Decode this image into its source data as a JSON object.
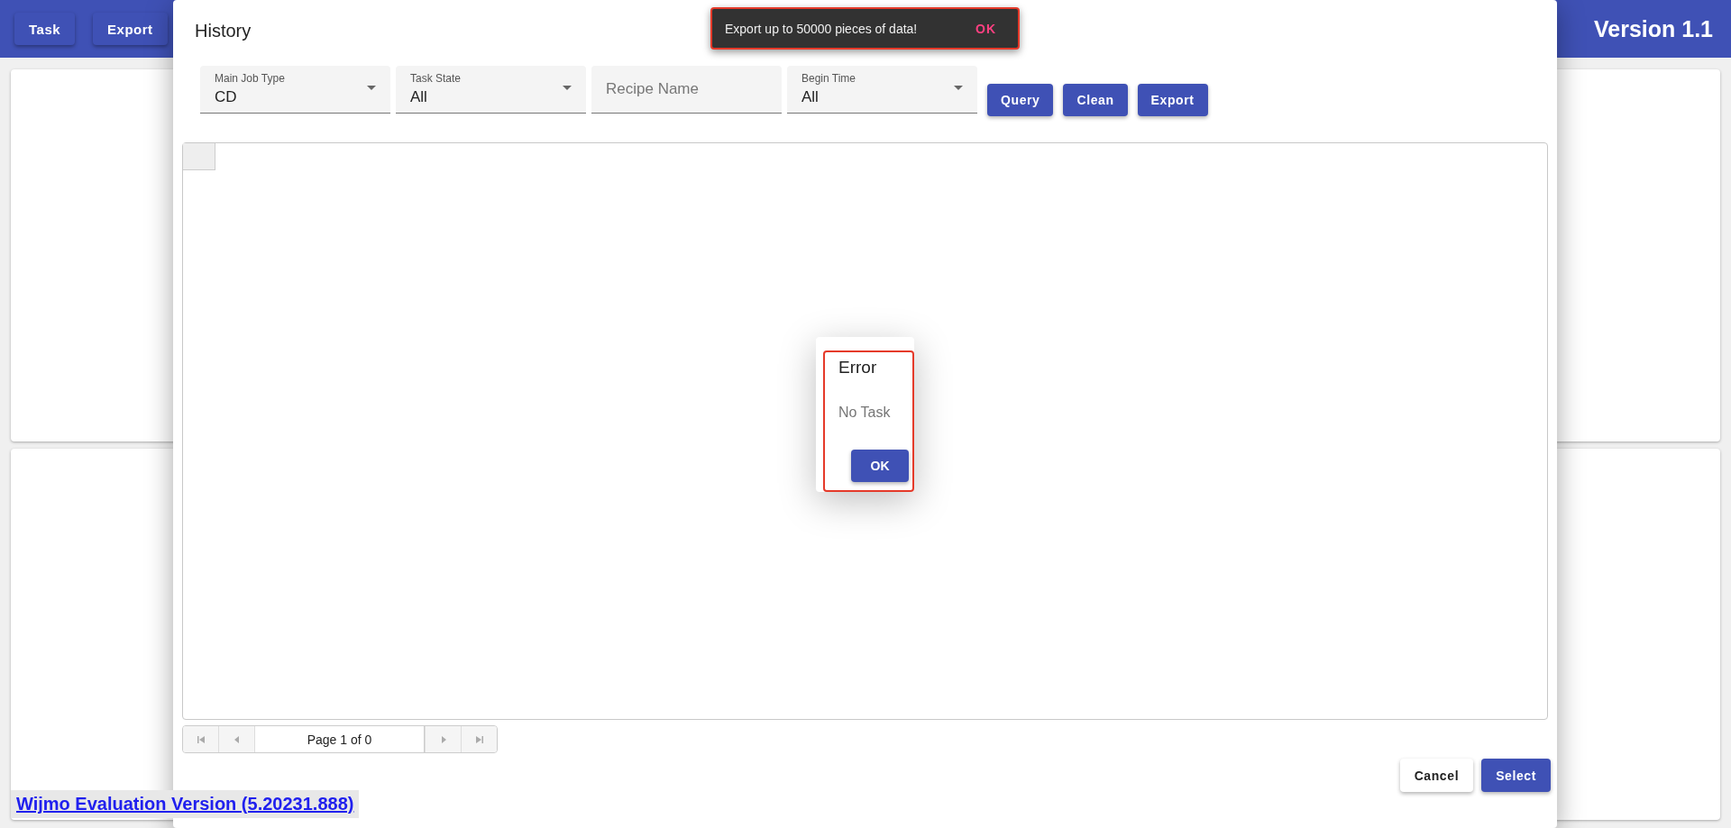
{
  "app_bar": {
    "buttons": [
      "Task",
      "Export"
    ],
    "version": "Version 1.1"
  },
  "dialog": {
    "title": "History",
    "filters": [
      {
        "kind": "select",
        "label": "Main Job Type",
        "value": "CD"
      },
      {
        "kind": "select",
        "label": "Task State",
        "value": "All"
      },
      {
        "kind": "text",
        "placeholder": "Recipe Name"
      },
      {
        "kind": "select",
        "label": "Begin Time",
        "value": "All"
      }
    ],
    "actions": [
      "Query",
      "Clean",
      "Export"
    ],
    "pager": {
      "text": "Page 1 of 0"
    },
    "footer": [
      {
        "label": "Cancel",
        "kind": "outlined"
      },
      {
        "label": "Select",
        "kind": "filled"
      }
    ]
  },
  "snackbar": {
    "message": "Export up to 50000 pieces of data!",
    "action": "OK"
  },
  "error_dialog": {
    "title": "Error",
    "message": "No Task",
    "button": "OK"
  },
  "evaluation_link": "Wijmo Evaluation Version (5.20231.888)"
}
